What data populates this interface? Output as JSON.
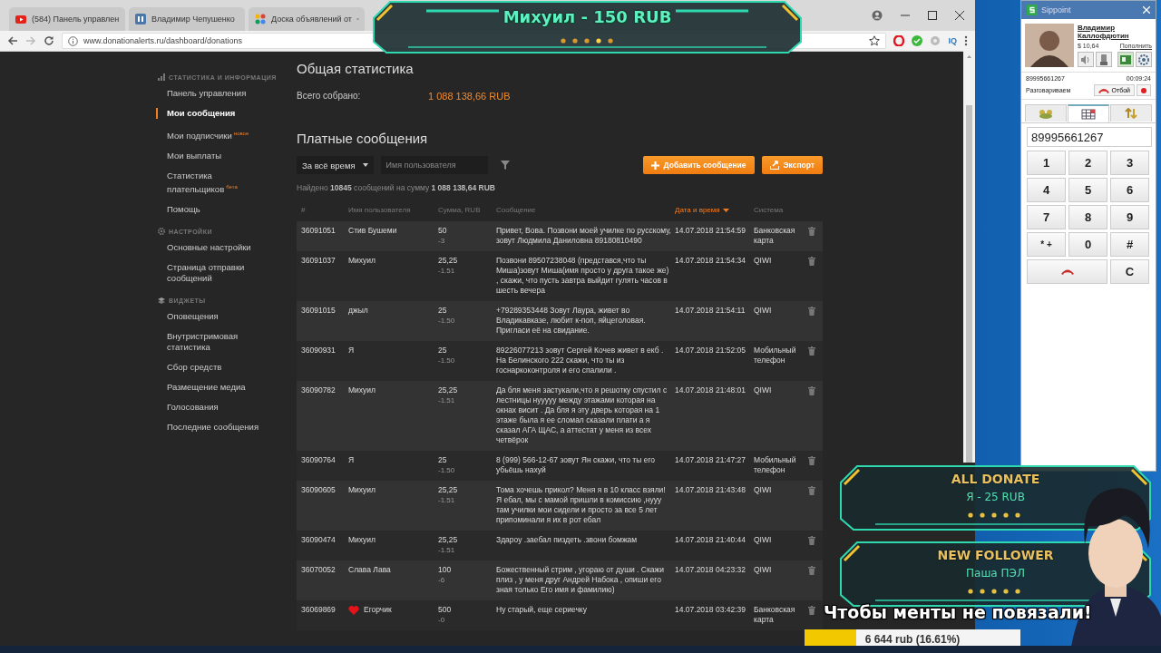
{
  "browser": {
    "tabs": [
      {
        "title": "(584) Панель управлен",
        "selected": false
      },
      {
        "title": "Владимир Чепушенко",
        "selected": false
      },
      {
        "title": "Доска объявлений от",
        "selected": false
      }
    ],
    "address": "www.donationalerts.ru/dashboard/donations",
    "extension_label": "IQ"
  },
  "sidebar": {
    "sections": [
      {
        "kind": "stats",
        "title": "СТАТИСТИКА И ИНФОРМАЦИЯ",
        "items": [
          {
            "label": "Панель управления",
            "selected": false
          },
          {
            "label": "Мои сообщения",
            "selected": true
          },
          {
            "label": "Мои подписчики",
            "badge": "новое",
            "selected": false
          },
          {
            "label": "Мои выплаты",
            "selected": false
          },
          {
            "label": "Статистика плательщиков",
            "badge": "бета",
            "selected": false
          },
          {
            "label": "Помощь",
            "selected": false
          }
        ]
      },
      {
        "kind": "settings",
        "title": "НАСТРОЙКИ",
        "items": [
          {
            "label": "Основные настройки",
            "selected": false
          },
          {
            "label": "Страница отправки сообщений",
            "selected": false
          }
        ]
      },
      {
        "kind": "widgets",
        "title": "ВИДЖЕТЫ",
        "items": [
          {
            "label": "Оповещения",
            "selected": false
          },
          {
            "label": "Внутристримовая статистика",
            "selected": false
          },
          {
            "label": "Сбор средств",
            "selected": false
          },
          {
            "label": "Размещение медиа",
            "selected": false
          },
          {
            "label": "Голосования",
            "selected": false
          },
          {
            "label": "Последние сообщения",
            "selected": false
          }
        ]
      }
    ]
  },
  "stats": {
    "title": "Общая статистика",
    "total_label": "Всего собрано:",
    "total_value": "1 088 138,66 RUB"
  },
  "messages": {
    "title": "Платные сообщения",
    "period": "За всё время",
    "search_placeholder": "Имя пользователя",
    "buttons": [
      {
        "kind": "add",
        "label": "Добавить сообщение"
      },
      {
        "kind": "export",
        "label": "Экспорт"
      }
    ],
    "summary": "Найдено **10845** сообщений на сумму **1 088 138,64 RUB**",
    "columns": [
      {
        "label": "#",
        "sorted": false
      },
      {
        "label": "Имя пользователя",
        "sorted": false
      },
      {
        "label": "Сумма, RUB",
        "sorted": false
      },
      {
        "label": "Сообщение",
        "sorted": false
      },
      {
        "label": "Дата и время",
        "sorted": true
      },
      {
        "label": "Система",
        "sorted": false
      }
    ],
    "rows": [
      {
        "id": "36091051",
        "user": "Стив Бушеми",
        "heart": false,
        "amount": "50",
        "fee": "-3",
        "message": "Привет, Вова. Позвони моей училке по русскому, зовут Людмила Даниловна 89180810490",
        "date": "14.07.2018 21:54:59",
        "system": "Банковская карта"
      },
      {
        "id": "36091037",
        "user": "Михуил",
        "heart": false,
        "amount": "25,25",
        "fee": "-1.51",
        "message": "Позвони 89507238048 (представся,что ты Миша)зовут Миша(имя просто у друга такое же) , скажи, что пусть завтра выйдит гулять часов в шесть вечера",
        "date": "14.07.2018 21:54:34",
        "system": "QIWI"
      },
      {
        "id": "36091015",
        "user": "джыл",
        "heart": false,
        "amount": "25",
        "fee": "-1.50",
        "message": "+79289353448 Зовут Лаура, живет во Владикавказе, любит к-поп, яйцеголовая. Пригласи её на свидание.",
        "date": "14.07.2018 21:54:11",
        "system": "QIWI"
      },
      {
        "id": "36090931",
        "user": "Я",
        "heart": false,
        "amount": "25",
        "fee": "-1.50",
        "message": "89226077213 зовут Сергей Кочев живет в екб . На Белинского 222 скажи, что ты из госнаркоконтроля и его спалили .",
        "date": "14.07.2018 21:52:05",
        "system": "Мобильный телефон"
      },
      {
        "id": "36090782",
        "user": "Михуил",
        "heart": false,
        "amount": "25,25",
        "fee": "-1.51",
        "message": "Да бля меня застукали,что я решотку спустил с лестницы нууууу между этажами которая на окнах висит . Да бля я эту дверь которая на 1 этаже была я ее сломал сказали плати а я сказал АГА ЩАС, а аттестат у меня из всех четвёрок",
        "date": "14.07.2018 21:48:01",
        "system": "QIWI"
      },
      {
        "id": "36090764",
        "user": "Я",
        "heart": false,
        "amount": "25",
        "fee": "-1.50",
        "message": "8 (999) 566-12-67 зовут Ян скажи, что ты его убьёшь нахуй",
        "date": "14.07.2018 21:47:27",
        "system": "Мобильный телефон"
      },
      {
        "id": "36090605",
        "user": "Михуил",
        "heart": false,
        "amount": "25,25",
        "fee": "-1.51",
        "message": "Тома хочешь прикол? Меня я в 10 класс взяли! Я ебал, мы с мамой пришли в комиссию ,нууу там училки мои сидели и просто за все 5 лет припоминали я их в рот ебал",
        "date": "14.07.2018 21:43:48",
        "system": "QIWI"
      },
      {
        "id": "36090474",
        "user": "Михуил",
        "heart": false,
        "amount": "25,25",
        "fee": "-1.51",
        "message": "Здароу .заебал пиздеть .звони бомжам",
        "date": "14.07.2018 21:40:44",
        "system": "QIWI"
      },
      {
        "id": "36070052",
        "user": "Слава Лава",
        "heart": false,
        "amount": "100",
        "fee": "-6",
        "message": "Божественный стрим , угораю от души . Скажи плиз , у меня друг Андрей Набока , опиши его зная только Его имя и фамилию)",
        "date": "14.07.2018 04:23:32",
        "system": "QIWI"
      },
      {
        "id": "36069869",
        "user": "Егорчик",
        "heart": true,
        "amount": "500",
        "fee": "-0",
        "message": "Ну старый, еще сериечку",
        "date": "14.07.2018 03:42:39",
        "system": "Банковская карта"
      }
    ]
  },
  "softphone": {
    "title": "Sippoint",
    "contact": {
      "name": "Владимир Каллофдютин",
      "balance": "$ 10,64",
      "top_up": "Пополнить"
    },
    "call": {
      "number": "89995661267",
      "duration": "00:09:24",
      "status": "Разговариваем",
      "hangup": "Отбой"
    },
    "tabs": [
      {
        "kind": "contacts",
        "selected": false
      },
      {
        "kind": "dialpad",
        "selected": true
      },
      {
        "kind": "transfers",
        "selected": false
      }
    ],
    "dial_value": "89995661267",
    "keys": [
      {
        "kind": "digit",
        "label": "1"
      },
      {
        "kind": "digit",
        "label": "2"
      },
      {
        "kind": "digit",
        "label": "3"
      },
      {
        "kind": "digit",
        "label": "4"
      },
      {
        "kind": "digit",
        "label": "5"
      },
      {
        "kind": "digit",
        "label": "6"
      },
      {
        "kind": "digit",
        "label": "7"
      },
      {
        "kind": "digit",
        "label": "8"
      },
      {
        "kind": "digit",
        "label": "9"
      },
      {
        "kind": "digit",
        "label": "* +"
      },
      {
        "kind": "digit",
        "label": "0"
      },
      {
        "kind": "digit",
        "label": "#"
      },
      {
        "kind": "hangup"
      },
      {
        "kind": "digit",
        "label": "C"
      }
    ]
  },
  "stream_overlay": {
    "top_alert": "Михуил - 150 RUB",
    "alerts": [
      {
        "title": "ALL DONATE",
        "text": "Я - 25 RUB"
      },
      {
        "title": "NEW FOLLOWER",
        "text": "Паша ПЭЛ"
      }
    ],
    "caption": "Чтобы менты не повязали!",
    "goal": {
      "text": "6 644 rub (16.61%)",
      "level": 0.24
    }
  }
}
